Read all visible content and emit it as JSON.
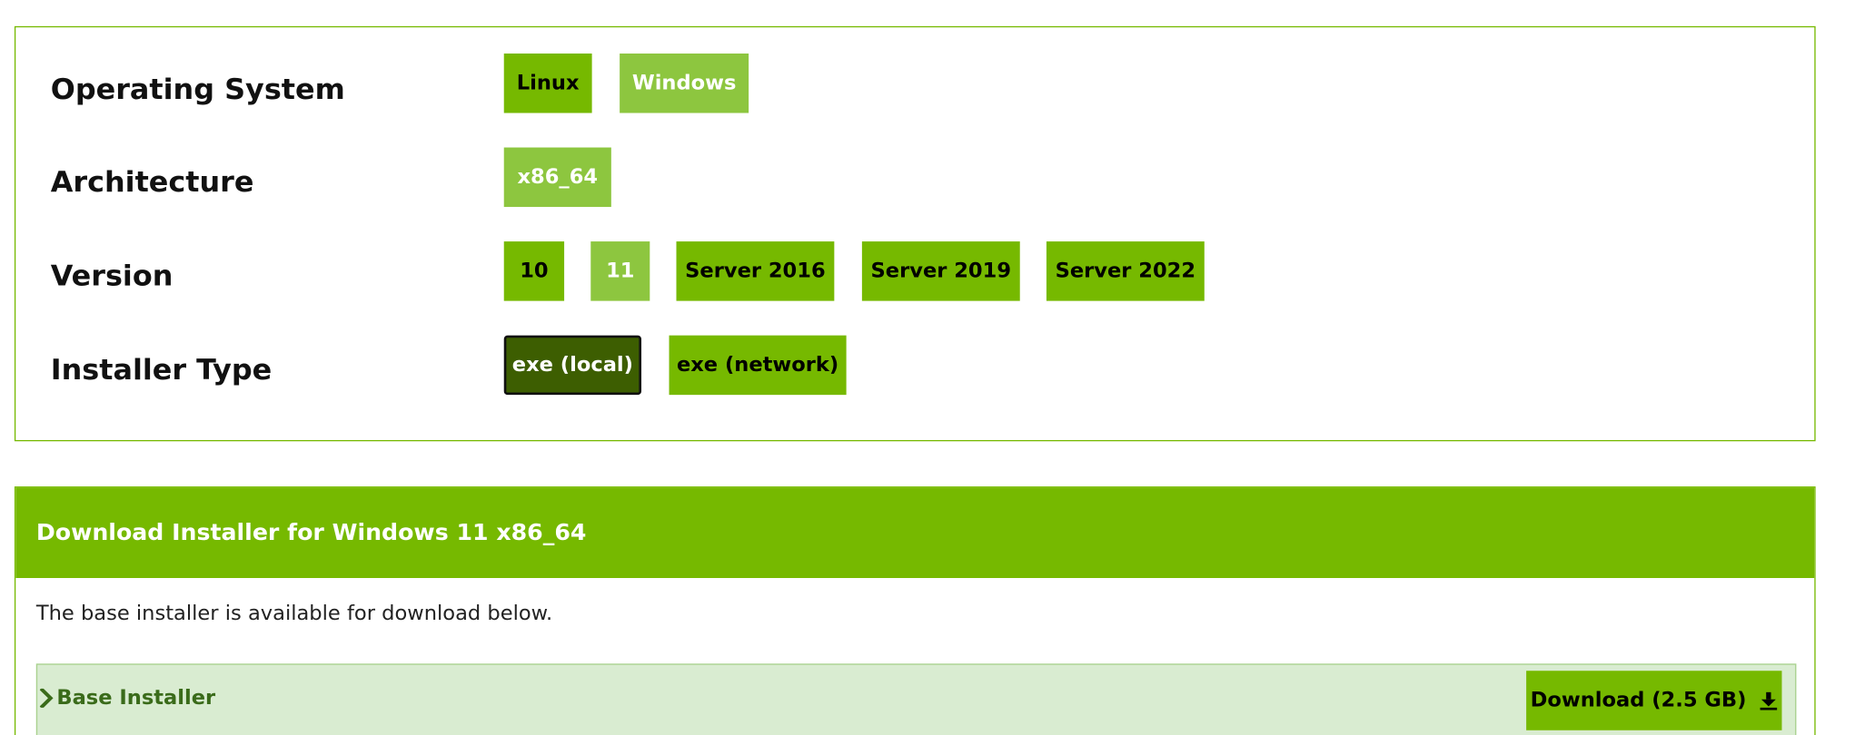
{
  "selector": {
    "rows": [
      {
        "label": "Operating System",
        "options": [
          "Linux",
          "Windows"
        ],
        "selected": "Windows"
      },
      {
        "label": "Architecture",
        "options": [
          "x86_64"
        ],
        "selected": "x86_64"
      },
      {
        "label": "Version",
        "options": [
          "10",
          "11",
          "Server 2016",
          "Server 2019",
          "Server 2022"
        ],
        "selected": "11"
      },
      {
        "label": "Installer Type",
        "options": [
          "exe (local)",
          "exe (network)"
        ],
        "selected": "exe (local)"
      }
    ]
  },
  "download": {
    "header": "Download Installer for Windows 11 x86_64",
    "description": "The base installer is available for download below.",
    "installer": {
      "title": "Base Installer",
      "button_label": "Download (2.5 GB)"
    }
  },
  "colors": {
    "accent": "#76b900",
    "selected": "#8dc63f",
    "focused": "#3d5e01",
    "installer_bg": "#d9ecd1",
    "installer_text": "#3a6b1a"
  },
  "icons": {
    "expand": "chevron-right-icon",
    "download": "download-icon"
  }
}
